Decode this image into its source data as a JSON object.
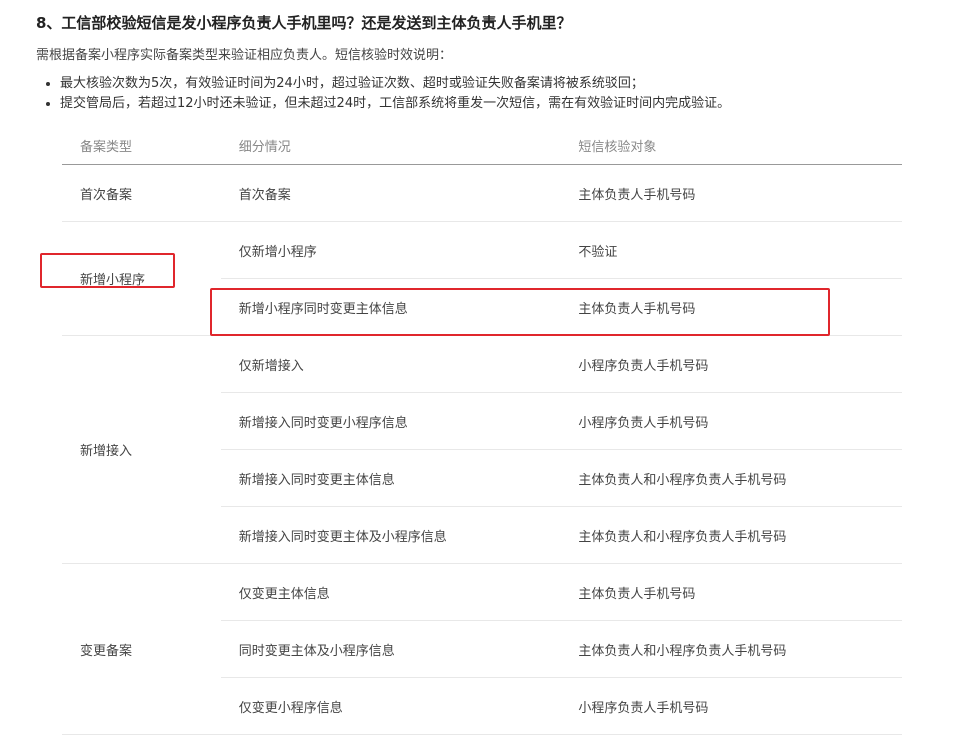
{
  "title": "8、工信部校验短信是发小程序负责人手机里吗？还是发送到主体负责人手机里？",
  "intro": "需根据备案小程序实际备案类型来验证相应负责人。短信核验时效说明：",
  "bullets": [
    "最大核验次数为5次，有效验证时间为24小时，超过验证次数、超时或验证失败备案请将被系统驳回；",
    "提交管局后，若超过12小时还未验证，但未超过24时，工信部系统将重发一次短信，需在有效验证时间内完成验证。"
  ],
  "table": {
    "headers": [
      "备案类型",
      "细分情况",
      "短信核验对象"
    ],
    "groups": [
      {
        "type": "首次备案",
        "rows": [
          {
            "detail": "首次备案",
            "target": "主体负责人手机号码"
          }
        ]
      },
      {
        "type": "新增小程序",
        "rows": [
          {
            "detail": "仅新增小程序",
            "target": "不验证"
          },
          {
            "detail": "新增小程序同时变更主体信息",
            "target": "主体负责人手机号码"
          }
        ]
      },
      {
        "type": "新增接入",
        "rows": [
          {
            "detail": "仅新增接入",
            "target": "小程序负责人手机号码"
          },
          {
            "detail": "新增接入同时变更小程序信息",
            "target": "小程序负责人手机号码"
          },
          {
            "detail": "新增接入同时变更主体信息",
            "target": "主体负责人和小程序负责人手机号码"
          },
          {
            "detail": "新增接入同时变更主体及小程序信息",
            "target": "主体负责人和小程序负责人手机号码"
          }
        ]
      },
      {
        "type": "变更备案",
        "rows": [
          {
            "detail": "仅变更主体信息",
            "target": "主体负责人手机号码"
          },
          {
            "detail": "同时变更主体及小程序信息",
            "target": "主体负责人和小程序负责人手机号码"
          },
          {
            "detail": "仅变更小程序信息",
            "target": "小程序负责人手机号码"
          }
        ]
      }
    ]
  },
  "colors": {
    "highlight": "#e0262c",
    "header_text": "#888888",
    "body_text": "#444444"
  }
}
